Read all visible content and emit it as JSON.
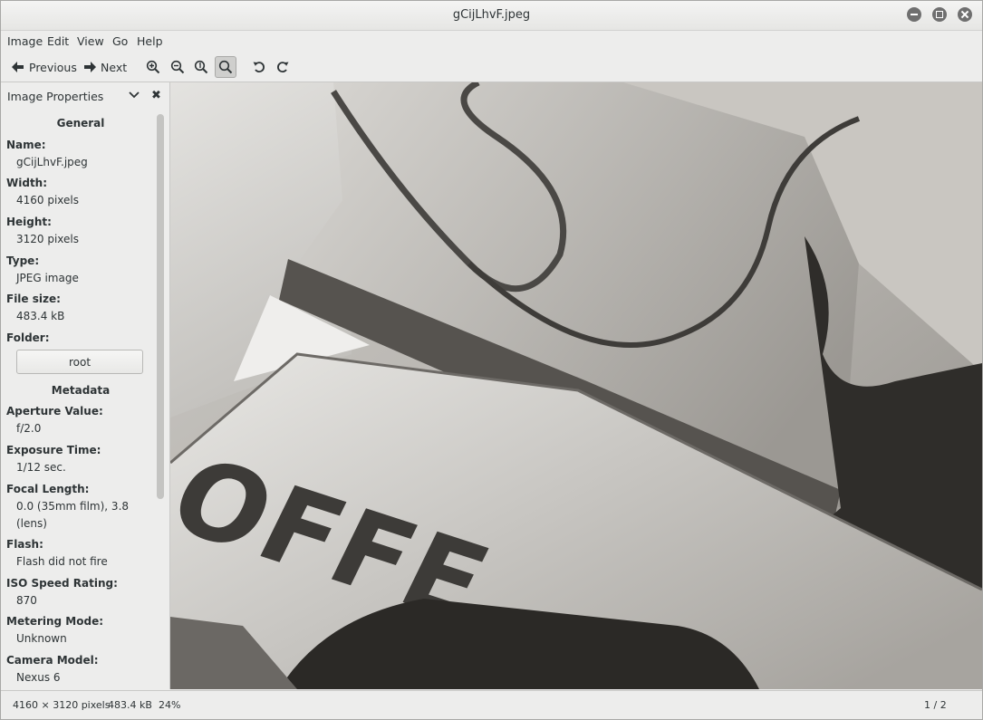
{
  "window": {
    "title": "gCijLhvF.jpeg"
  },
  "menubar": {
    "items": [
      "Image",
      "Edit",
      "View",
      "Go",
      "Help"
    ]
  },
  "toolbar": {
    "previous_label": "Previous",
    "next_label": "Next"
  },
  "sidebar": {
    "header": "Image Properties",
    "general_title": "General",
    "metadata_title": "Metadata",
    "properties": [
      {
        "label": "Name:",
        "value": "gCijLhvF.jpeg"
      },
      {
        "label": "Width:",
        "value": "4160 pixels"
      },
      {
        "label": "Height:",
        "value": "3120 pixels"
      },
      {
        "label": "Type:",
        "value": "JPEG image"
      },
      {
        "label": "File size:",
        "value": "483.4 kB"
      },
      {
        "label": "Folder:",
        "value": "root"
      }
    ],
    "metadata": [
      {
        "label": "Aperture Value:",
        "value": "f/2.0"
      },
      {
        "label": "Exposure Time:",
        "value": "1/12 sec."
      },
      {
        "label": "Focal Length:",
        "value": "0.0 (35mm film), 3.8 (lens)"
      },
      {
        "label": "Flash:",
        "value": "Flash did not fire"
      },
      {
        "label": "ISO Speed Rating:",
        "value": "870"
      },
      {
        "label": "Metering Mode:",
        "value": "Unknown"
      },
      {
        "label": "Camera Model:",
        "value": "Nexus 6"
      }
    ]
  },
  "image": {
    "visible_text": "OFFE"
  },
  "statusbar": {
    "dimensions": "4160 × 3120 pixels",
    "size": "483.4 kB",
    "zoom": "24%",
    "position": "1 / 2"
  }
}
